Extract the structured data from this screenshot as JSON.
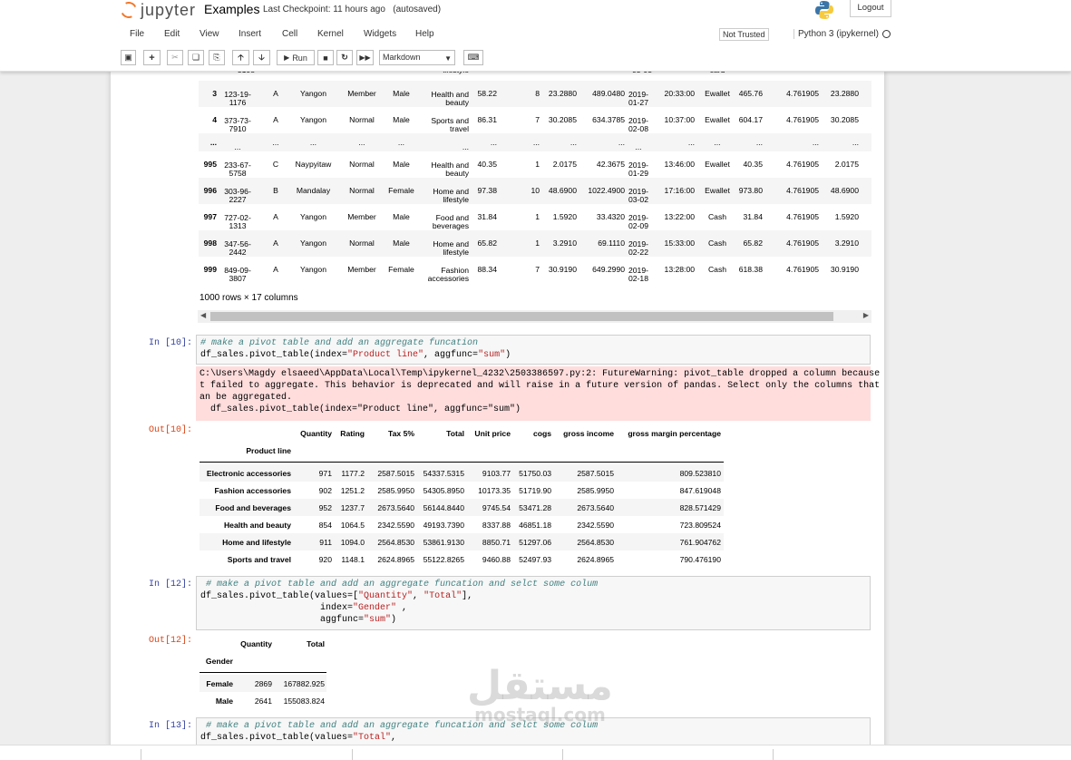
{
  "header": {
    "logo_text": "jupyter",
    "notebook_name": "Examples",
    "checkpoint_label": "Last Checkpoint:",
    "checkpoint_time": "11 hours ago",
    "autosaved": "(autosaved)",
    "logout": "Logout"
  },
  "menu": {
    "items": [
      "File",
      "Edit",
      "View",
      "Insert",
      "Cell",
      "Kernel",
      "Widgets",
      "Help"
    ],
    "not_trusted": "Not Trusted",
    "kernel": "Python 3 (ipykernel)"
  },
  "toolbar": {
    "run_label": "Run",
    "cell_type": "Markdown",
    "icons": [
      "save-icon",
      "add-cell-icon",
      "cut-icon",
      "copy-icon",
      "paste-icon",
      "move-up-icon",
      "move-down-icon",
      "run-icon",
      "stop-icon",
      "restart-icon",
      "fast-forward-icon",
      "keyboard-icon"
    ]
  },
  "big_table": {
    "partial_row": [
      "3108",
      "-",
      "lifestyle",
      "03-03",
      "card"
    ],
    "rows": [
      {
        "idx": "3",
        "invoice": [
          "123-19-",
          "1176"
        ],
        "branch": "A",
        "city": "Yangon",
        "customer": "Member",
        "gender": "Male",
        "product": [
          "Health and",
          "beauty"
        ],
        "price": "58.22",
        "qty": "8",
        "tax": "23.2880",
        "total": "489.0480",
        "date": [
          "2019-",
          "01-27"
        ],
        "time": "20:33:00",
        "payment": "Ewallet",
        "cogs": "465.76",
        "margin": "4.761905",
        "income": "23.2880"
      },
      {
        "idx": "4",
        "invoice": [
          "373-73-",
          "7910"
        ],
        "branch": "A",
        "city": "Yangon",
        "customer": "Normal",
        "gender": "Male",
        "product": [
          "Sports and",
          "travel"
        ],
        "price": "86.31",
        "qty": "7",
        "tax": "30.2085",
        "total": "634.3785",
        "date": [
          "2019-",
          "02-08"
        ],
        "time": "10:37:00",
        "payment": "Ewallet",
        "cogs": "604.17",
        "margin": "4.761905",
        "income": "30.2085"
      },
      {
        "idx": "...",
        "invoice": [
          "..."
        ],
        "branch": "...",
        "city": "...",
        "customer": "...",
        "gender": "...",
        "product": [
          "..."
        ],
        "price": "...",
        "qty": "...",
        "tax": "...",
        "total": "...",
        "date": [
          "..."
        ],
        "time": "...",
        "payment": "...",
        "cogs": "...",
        "margin": "...",
        "income": "..."
      },
      {
        "idx": "995",
        "invoice": [
          "233-67-",
          "5758"
        ],
        "branch": "C",
        "city": "Naypyitaw",
        "customer": "Normal",
        "gender": "Male",
        "product": [
          "Health and",
          "beauty"
        ],
        "price": "40.35",
        "qty": "1",
        "tax": "2.0175",
        "total": "42.3675",
        "date": [
          "2019-",
          "01-29"
        ],
        "time": "13:46:00",
        "payment": "Ewallet",
        "cogs": "40.35",
        "margin": "4.761905",
        "income": "2.0175"
      },
      {
        "idx": "996",
        "invoice": [
          "303-96-",
          "2227"
        ],
        "branch": "B",
        "city": "Mandalay",
        "customer": "Normal",
        "gender": "Female",
        "product": [
          "Home and",
          "lifestyle"
        ],
        "price": "97.38",
        "qty": "10",
        "tax": "48.6900",
        "total": "1022.4900",
        "date": [
          "2019-",
          "03-02"
        ],
        "time": "17:16:00",
        "payment": "Ewallet",
        "cogs": "973.80",
        "margin": "4.761905",
        "income": "48.6900"
      },
      {
        "idx": "997",
        "invoice": [
          "727-02-",
          "1313"
        ],
        "branch": "A",
        "city": "Yangon",
        "customer": "Member",
        "gender": "Male",
        "product": [
          "Food and",
          "beverages"
        ],
        "price": "31.84",
        "qty": "1",
        "tax": "1.5920",
        "total": "33.4320",
        "date": [
          "2019-",
          "02-09"
        ],
        "time": "13:22:00",
        "payment": "Cash",
        "cogs": "31.84",
        "margin": "4.761905",
        "income": "1.5920"
      },
      {
        "idx": "998",
        "invoice": [
          "347-56-",
          "2442"
        ],
        "branch": "A",
        "city": "Yangon",
        "customer": "Normal",
        "gender": "Male",
        "product": [
          "Home and",
          "lifestyle"
        ],
        "price": "65.82",
        "qty": "1",
        "tax": "3.2910",
        "total": "69.1110",
        "date": [
          "2019-",
          "02-22"
        ],
        "time": "15:33:00",
        "payment": "Cash",
        "cogs": "65.82",
        "margin": "4.761905",
        "income": "3.2910"
      },
      {
        "idx": "999",
        "invoice": [
          "849-09-",
          "3807"
        ],
        "branch": "A",
        "city": "Yangon",
        "customer": "Member",
        "gender": "Female",
        "product": [
          "Fashion",
          "accessories"
        ],
        "price": "88.34",
        "qty": "7",
        "tax": "30.9190",
        "total": "649.2990",
        "date": [
          "2019-",
          "02-18"
        ],
        "time": "13:28:00",
        "payment": "Cash",
        "cogs": "618.38",
        "margin": "4.761905",
        "income": "30.9190"
      }
    ],
    "shape_text": "1000 rows × 17 columns"
  },
  "cell10": {
    "in_prompt": "In [10]:",
    "out_prompt": "Out[10]:",
    "comment": "# make a pivot table and add an aggregate funcation",
    "code_pre": "df_sales.pivot_table(index=",
    "code_str1": "\"Product line\"",
    "code_mid": ", aggfunc=",
    "code_str2": "\"sum\"",
    "code_post": ")",
    "stderr": "C:\\Users\\Magdy elsaeed\\AppData\\Local\\Temp\\ipykernel_4232\\2503386597.py:2: FutureWarning: pivot_table dropped a column because i\nt failed to aggregate. This behavior is deprecated and will raise in a future version of pandas. Select only the columns that c\nan be aggregated.\n  df_sales.pivot_table(index=\"Product line\", aggfunc=\"sum\")",
    "columns": [
      "Quantity",
      "Rating",
      "Tax 5%",
      "Total",
      "Unit price",
      "cogs",
      "gross income",
      "gross margin percentage"
    ],
    "index_name": "Product line",
    "rows": [
      {
        "name": "Electronic accessories",
        "vals": [
          "971",
          "1177.2",
          "2587.5015",
          "54337.5315",
          "9103.77",
          "51750.03",
          "2587.5015",
          "809.523810"
        ]
      },
      {
        "name": "Fashion accessories",
        "vals": [
          "902",
          "1251.2",
          "2585.9950",
          "54305.8950",
          "10173.35",
          "51719.90",
          "2585.9950",
          "847.619048"
        ]
      },
      {
        "name": "Food and beverages",
        "vals": [
          "952",
          "1237.7",
          "2673.5640",
          "56144.8440",
          "9745.54",
          "53471.28",
          "2673.5640",
          "828.571429"
        ]
      },
      {
        "name": "Health and beauty",
        "vals": [
          "854",
          "1064.5",
          "2342.5590",
          "49193.7390",
          "8337.88",
          "46851.18",
          "2342.5590",
          "723.809524"
        ]
      },
      {
        "name": "Home and lifestyle",
        "vals": [
          "911",
          "1094.0",
          "2564.8530",
          "53861.9130",
          "8850.71",
          "51297.06",
          "2564.8530",
          "761.904762"
        ]
      },
      {
        "name": "Sports and travel",
        "vals": [
          "920",
          "1148.1",
          "2624.8965",
          "55122.8265",
          "9460.88",
          "52497.93",
          "2624.8965",
          "790.476190"
        ]
      }
    ]
  },
  "cell12": {
    "in_prompt": "In [12]:",
    "out_prompt": "Out[12]:",
    "comment": " # make a pivot table and add an aggregate funcation and selct some colum",
    "line1_pre": "df_sales.pivot_table(values=[",
    "line1_s1": "\"Quantity\"",
    "line1_mid": ", ",
    "line1_s2": "\"Total\"",
    "line1_post": "],",
    "line2_pre": "                      index=",
    "line2_s": "\"Gender\"",
    "line2_post": " ,",
    "line3_pre": "                      aggfunc=",
    "line3_s": "\"sum\"",
    "line3_post": ")",
    "columns": [
      "Quantity",
      "Total"
    ],
    "index_name": "Gender",
    "rows": [
      {
        "name": "Female",
        "vals": [
          "2869",
          "167882.925"
        ]
      },
      {
        "name": "Male",
        "vals": [
          "2641",
          "155083.824"
        ]
      }
    ]
  },
  "cell13": {
    "in_prompt": "In [13]:",
    "comment": " # make a pivot table and add an aggregate funcation and selct some colum",
    "line1_pre": "df_sales.pivot_table(values=",
    "line1_s": "\"Total\"",
    "line1_post": ","
  },
  "watermark": {
    "arabic": "مستقل",
    "latin": "mostaql.com"
  }
}
